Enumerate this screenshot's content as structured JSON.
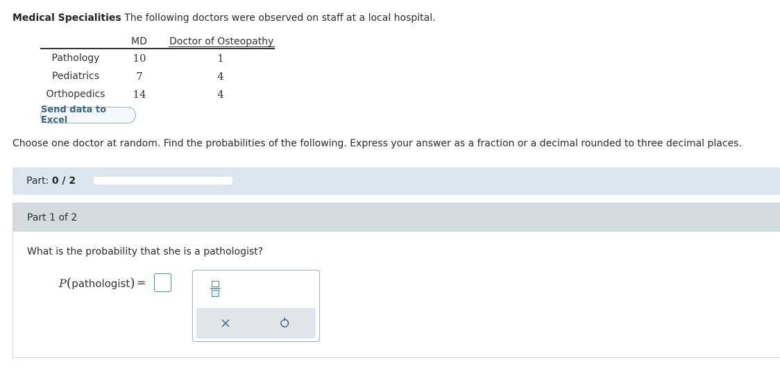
{
  "intro": {
    "title": "Medical Specialities",
    "text": "The following doctors were observed on staff at a local hospital."
  },
  "table": {
    "col_headers": [
      "MD",
      "Doctor of Osteopathy"
    ],
    "rows": [
      {
        "label": "Pathology",
        "md": "10",
        "do": "1"
      },
      {
        "label": "Pediatrics",
        "md": "7",
        "do": "4"
      },
      {
        "label": "Orthopedics",
        "md": "14",
        "do": "4"
      }
    ]
  },
  "excel_button": "Send data to Excel",
  "instructions": "Choose one doctor at random. Find the probabilities of the following. Express your answer as a fraction or a decimal rounded to three decimal places.",
  "part_bar": {
    "label": "Part:",
    "value": "0 / 2",
    "progress": 0
  },
  "part_panel": {
    "header": "Part 1 of 2",
    "question": "What is the probability that she is a pathologist?",
    "expr_p": "P",
    "expr_arg": "pathologist",
    "expr_eq": "="
  },
  "icons": {
    "fraction": "fraction-icon",
    "clear": "close-icon",
    "undo": "undo-icon"
  },
  "colors": {
    "accent": "#4c8bb5",
    "part_bar_bg": "#dce6ef",
    "panel_header_bg": "#d4dbdf"
  }
}
